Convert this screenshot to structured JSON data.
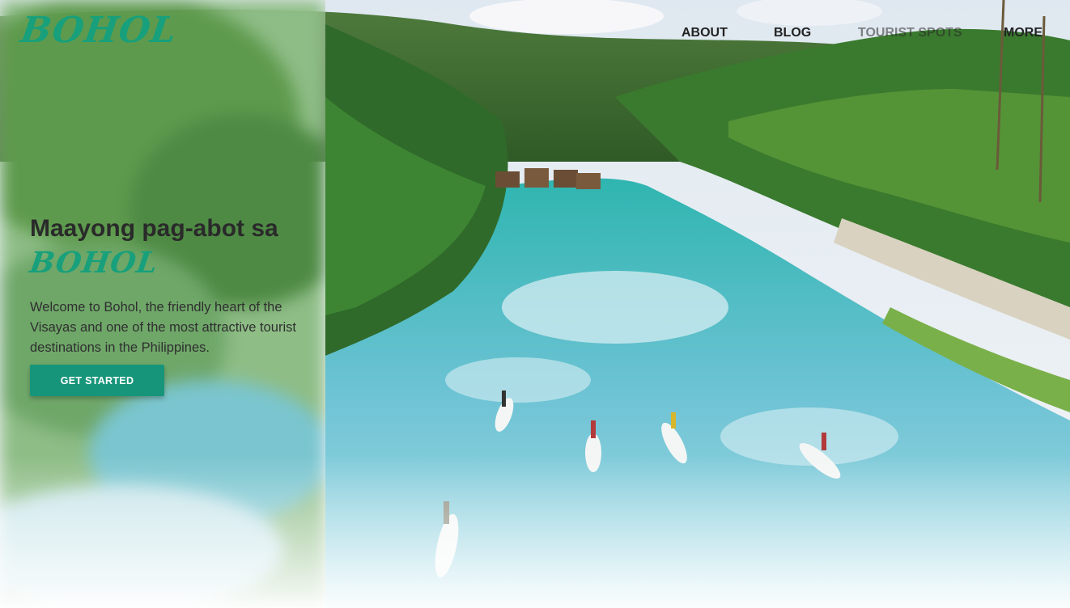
{
  "brand": {
    "logo_text": "BOHOL",
    "accent_color": "#17a07b"
  },
  "nav": {
    "items": [
      {
        "label": "ABOUT"
      },
      {
        "label": "BLOG"
      },
      {
        "label": "TOURIST SPOTS"
      },
      {
        "label": "MORE"
      }
    ]
  },
  "hero": {
    "headline": "Maayong pag-abot sa",
    "headline_brand": "BOHOL",
    "description": "Welcome to Bohol, the friendly heart of the Visayas and one of the most attractive tourist destinations in the Philippines.",
    "cta_label": "GET STARTED",
    "cta_color": "#17957a",
    "photo_subject": "aerial view of paddle boarders on a turquoise river lined with palm trees"
  }
}
